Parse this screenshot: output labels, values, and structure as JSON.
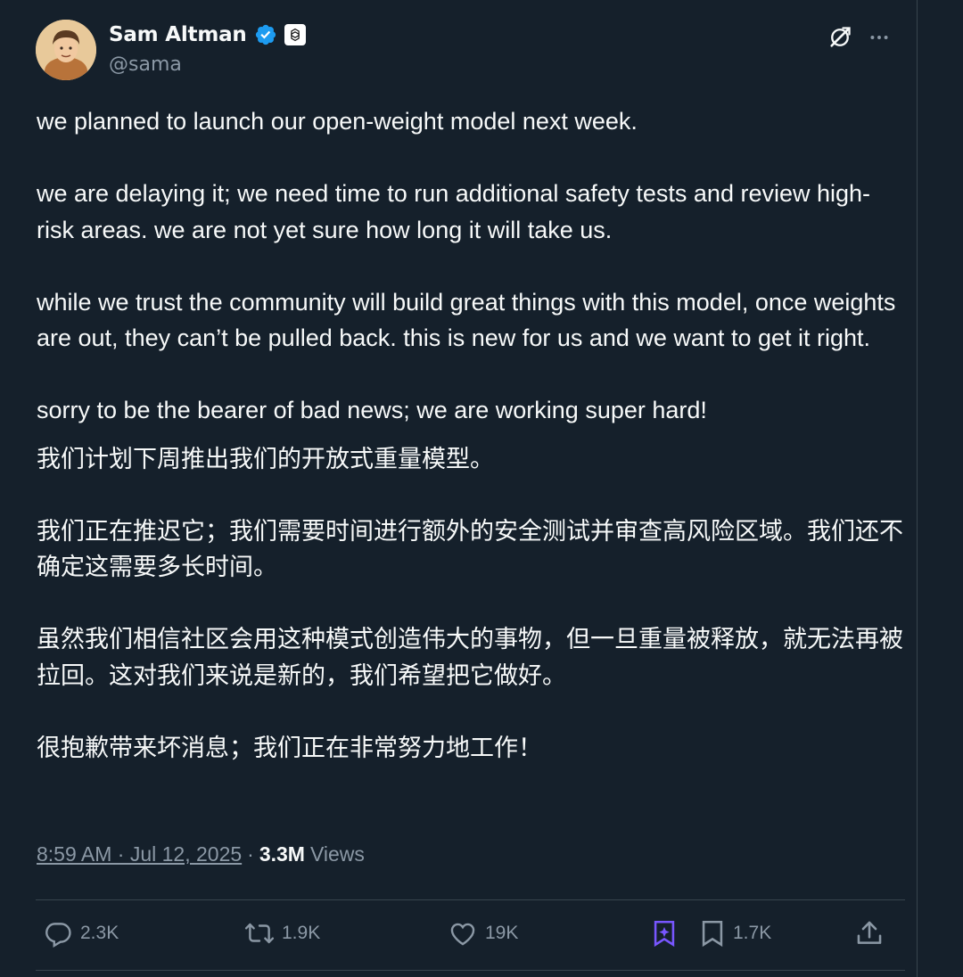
{
  "author": {
    "name": "Sam Altman",
    "handle": "@sama",
    "avatar_icon": "avatar-photo",
    "verified_icon": "verified-badge-icon",
    "affiliation_icon": "openai-logo-icon"
  },
  "header_actions": {
    "grok_icon": "grok-icon",
    "more_icon": "more-options-icon"
  },
  "post": {
    "en": [
      "we planned to launch our open-weight model next week.",
      "we are delaying it; we need time to run additional safety tests and review high-risk areas. we are not yet sure how long it will take us.",
      "while we trust the community will build great things with this model, once weights are out, they can’t be pulled back. this is new for us and we want to get it right.",
      "sorry to be the bearer of bad news; we are working super hard!"
    ],
    "zh": [
      "我们计划下周推出我们的开放式重量模型。",
      "我们正在推迟它；我们需要时间进行额外的安全测试并审查高风险区域。我们还不确定这需要多长时间。",
      "虽然我们相信社区会用这种模式创造伟大的事物，但一旦重量被释放，就无法再被拉回。这对我们来说是新的，我们希望把它做好。",
      "很抱歉带来坏消息；我们正在非常努力地工作！"
    ]
  },
  "meta": {
    "timestamp": "8:59 AM · Jul 12, 2025",
    "separator": "·",
    "views_count": "3.3M",
    "views_label": "Views"
  },
  "actions": {
    "reply": {
      "icon": "reply-icon",
      "count": "2.3K"
    },
    "repost": {
      "icon": "repost-icon",
      "count": "1.9K"
    },
    "like": {
      "icon": "like-icon",
      "count": "19K"
    },
    "grok_bookmark": {
      "icon": "grok-analyze-icon"
    },
    "bookmark": {
      "icon": "bookmark-icon",
      "count": "1.7K"
    },
    "share": {
      "icon": "share-icon"
    }
  },
  "colors": {
    "background": "#15202b",
    "text": "#f7f9f9",
    "muted": "#8b98a5",
    "verified": "#1d9bf0",
    "grok_purple": "#7856ff",
    "border": "#38444d"
  }
}
